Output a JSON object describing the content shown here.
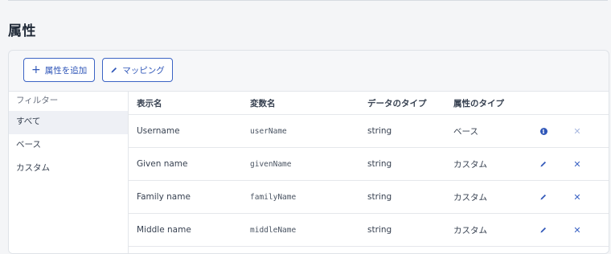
{
  "section_title": "属性",
  "toolbar": {
    "add_attribute_label": "属性を追加",
    "add_attribute_icon": "plus-icon",
    "mapping_label": "マッピング",
    "mapping_icon": "pencil-icon",
    "accent_color": "#2f56b8"
  },
  "sidebar": {
    "header": "フィルター",
    "items": [
      {
        "label": "すべて",
        "active": true
      },
      {
        "label": "ベース",
        "active": false
      },
      {
        "label": "カスタム",
        "active": false
      }
    ]
  },
  "table": {
    "columns": [
      "表示名",
      "変数名",
      "データのタイプ",
      "属性のタイプ"
    ],
    "rows": [
      {
        "display_name": "Username",
        "variable_name": "userName",
        "data_type": "string",
        "attribute_type": "ベース",
        "action_icon": "info-icon",
        "delete_icon": "close-icon",
        "delete_disabled": true
      },
      {
        "display_name": "Given name",
        "variable_name": "givenName",
        "data_type": "string",
        "attribute_type": "カスタム",
        "action_icon": "pencil-icon",
        "delete_icon": "close-icon",
        "delete_disabled": false
      },
      {
        "display_name": "Family name",
        "variable_name": "familyName",
        "data_type": "string",
        "attribute_type": "カスタム",
        "action_icon": "pencil-icon",
        "delete_icon": "close-icon",
        "delete_disabled": false
      },
      {
        "display_name": "Middle name",
        "variable_name": "middleName",
        "data_type": "string",
        "attribute_type": "カスタム",
        "action_icon": "pencil-icon",
        "delete_icon": "close-icon",
        "delete_disabled": false
      }
    ]
  }
}
